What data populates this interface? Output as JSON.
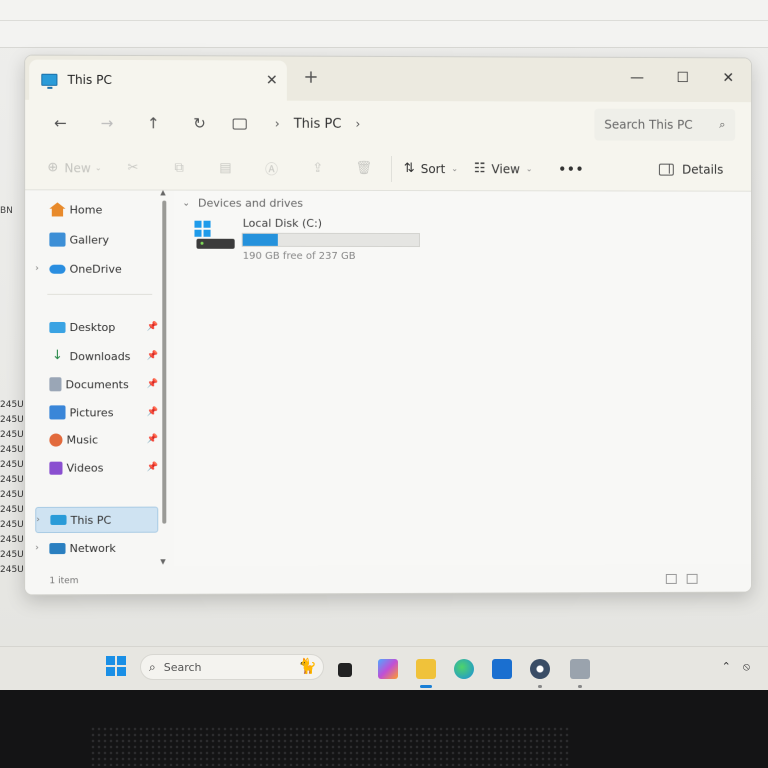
{
  "background": {
    "left_label": "BN",
    "left_list": [
      "245U",
      "245U",
      "245U",
      "245U",
      "245U",
      "245U",
      "245U",
      "245U",
      "245U",
      "245U",
      "245U",
      "245U"
    ]
  },
  "window": {
    "tab_title": "This PC",
    "close_tab_glyph": "✕",
    "new_tab_glyph": "+",
    "controls": {
      "minimize": "—",
      "maximize": "☐",
      "close": "✕"
    }
  },
  "nav": {
    "back": "←",
    "forward": "→",
    "up": "↑",
    "refresh": "↻",
    "breadcrumb": [
      "This PC"
    ],
    "search_placeholder": "Search This PC"
  },
  "commandbar": {
    "new_label": "New",
    "sort_label": "Sort",
    "view_label": "View",
    "more_label": "•••",
    "details_label": "Details"
  },
  "sidebar": {
    "items": [
      {
        "label": "Home",
        "icon": "home-icon",
        "color": "#e88a2b"
      },
      {
        "label": "Gallery",
        "icon": "gallery-icon",
        "color": "#3d8fd6"
      },
      {
        "label": "OneDrive",
        "icon": "cloud-icon",
        "color": "#2a8ee0"
      },
      {
        "label": "Desktop",
        "icon": "desktop-icon",
        "color": "#3aa3e3"
      },
      {
        "label": "Downloads",
        "icon": "download-icon",
        "color": "#2a8a4a"
      },
      {
        "label": "Documents",
        "icon": "document-icon",
        "color": "#7d8ea5"
      },
      {
        "label": "Pictures",
        "icon": "pictures-icon",
        "color": "#3a86d8"
      },
      {
        "label": "Music",
        "icon": "music-icon",
        "color": "#e26a3c"
      },
      {
        "label": "Videos",
        "icon": "video-icon",
        "color": "#8a4fd0"
      },
      {
        "label": "This PC",
        "icon": "pc-icon",
        "color": "#2a9bd8"
      },
      {
        "label": "Network",
        "icon": "network-icon",
        "color": "#2a7fc0"
      }
    ]
  },
  "content": {
    "group_header": "Devices and drives",
    "drive": {
      "name": "Local Disk (C:)",
      "free_text": "190 GB free of 237 GB",
      "used_fraction": 0.2
    }
  },
  "status": {
    "item_count": "1 item"
  },
  "taskbar": {
    "search_placeholder": "Search",
    "apps": [
      "task-view-icon",
      "copilot-icon",
      "file-explorer-icon",
      "edge-icon",
      "store-icon",
      "settings-icon",
      "device-icon"
    ]
  },
  "colors": {
    "accent": "#2592dc",
    "selection": "#cfe3f2"
  }
}
